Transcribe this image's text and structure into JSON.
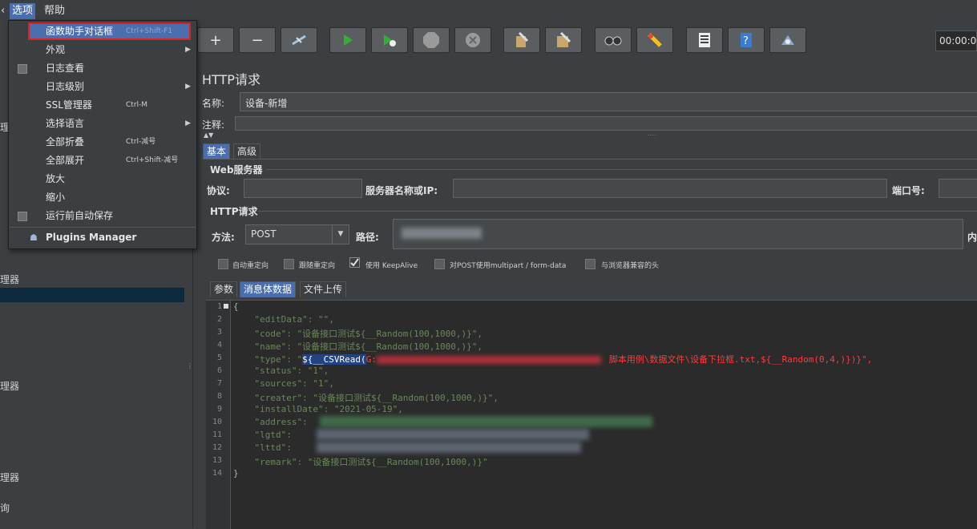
{
  "menubar": {
    "left_fragment": "‹",
    "options": "选项",
    "help": "帮助"
  },
  "toolbar": {
    "timer": "00:00:0",
    "icons": [
      "add-icon",
      "remove-icon",
      "toggle-icon",
      "start-icon",
      "start-no-pause-icon",
      "stop-icon",
      "shutdown-icon",
      "clear-icon",
      "clear-all-icon",
      "search-icon",
      "reset-search-icon",
      "function-helper-icon",
      "help-icon",
      "remote-icon"
    ]
  },
  "left_tree": {
    "items": [
      "理",
      "理器",
      "理器",
      "理器",
      "询"
    ],
    "top_fragment": "‹"
  },
  "dropdown": {
    "items": [
      {
        "label": "函数助手对话框",
        "shortcut": "Ctrl+Shift-F1",
        "highlight": true
      },
      {
        "label": "外观",
        "submenu": true
      },
      {
        "label": "日志查看",
        "checkbox": true
      },
      {
        "label": "日志级别",
        "submenu": true
      },
      {
        "label": "SSL管理器",
        "shortcut": "Ctrl-M"
      },
      {
        "label": "选择语言",
        "submenu": true
      },
      {
        "label": "全部折叠",
        "shortcut": "Ctrl-减号"
      },
      {
        "label": "全部展开",
        "shortcut": "Ctrl+Shift-减号"
      },
      {
        "label": "放大"
      },
      {
        "label": "缩小"
      },
      {
        "label": "运行前自动保存",
        "checkbox": true
      }
    ],
    "plugins": "Plugins Manager"
  },
  "http": {
    "title": "HTTP请求",
    "name_label": "名称:",
    "name_value": "设备-新增",
    "comment_label": "注释:",
    "tabs": [
      "基本",
      "高级"
    ],
    "web_server": "Web服务器",
    "protocol_label": "协议:",
    "server_label": "服务器名称或IP:",
    "port_label": "端口号:",
    "http_section": "HTTP请求",
    "method_label": "方法:",
    "method_value": "POST",
    "path_label": "路径:",
    "right_fragment": "内",
    "checkboxes": [
      {
        "label": "自动重定向",
        "checked": false
      },
      {
        "label": "跟随重定向",
        "checked": false
      },
      {
        "label": "使用 KeepAlive",
        "checked": true
      },
      {
        "label": "对POST使用multipart / form-data",
        "checked": false
      },
      {
        "label": "与浏览器兼容的头",
        "checked": false
      }
    ],
    "body_tabs": [
      "参数",
      "消息体数据",
      "文件上传"
    ]
  },
  "editor": {
    "line_numbers": [
      "1",
      "2",
      "3",
      "4",
      "5",
      "6",
      "7",
      "8",
      "9",
      "10",
      "11",
      "12",
      "13",
      "14"
    ],
    "l1": "{",
    "l2": "    \"editData\": \"\",",
    "l3": "    \"code\": \"设备接口测试${__Random(100,1000,)}\",",
    "l4": "    \"name\": \"设备接口测试${__Random(100,1000,)}\",",
    "l5_key": "    \"type\": \"",
    "l5_sel": "${__CSVRead(",
    "l5_red1": "G:",
    "l5_red2": "脚本用例\\数据文件\\设备下拉框.txt,${__Random(0,4,)})}\",",
    "l6": "    \"status\": \"1\",",
    "l7": "    \"sources\": \"1\",",
    "l8": "    \"creater\": \"设备接口测试${__Random(100,1000,)}\",",
    "l9": "    \"installDate\": \"2021-05-19\",",
    "l10": "    \"address\":",
    "l11": "    \"lgtd\":",
    "l12": "    \"lttd\":",
    "l13": "    \"remark\": \"设备接口测试${__Random(100,1000,)}\"",
    "l14": "}"
  }
}
